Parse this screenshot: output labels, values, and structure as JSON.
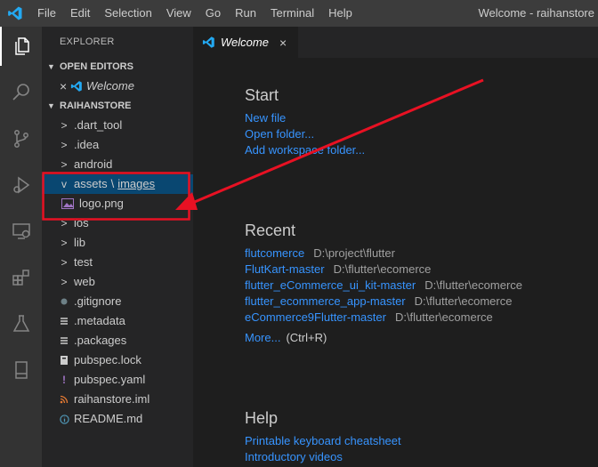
{
  "menu": [
    "File",
    "Edit",
    "Selection",
    "View",
    "Go",
    "Run",
    "Terminal",
    "Help"
  ],
  "window_title": "Welcome - raihanstore",
  "activity": [
    "explorer-icon",
    "search-icon",
    "source-control-icon",
    "run-debug-icon",
    "remote-explorer-icon",
    "extensions-icon",
    "testing-icon",
    "device-icon"
  ],
  "sidebar": {
    "title": "EXPLORER",
    "open_editors": {
      "label": "OPEN EDITORS",
      "items": [
        {
          "close": "×",
          "name": "Welcome"
        }
      ]
    },
    "project": {
      "label": "RAIHANSTORE",
      "items": [
        {
          "chevron": ">",
          "label": ".dart_tool"
        },
        {
          "chevron": ">",
          "label": ".idea"
        },
        {
          "chevron": ">",
          "label": "android"
        },
        {
          "chevron": "v",
          "label": "assets",
          "sep": "\\",
          "sub": "images"
        },
        {
          "label": "logo.png"
        },
        {
          "chevron": ">",
          "label": "ios"
        },
        {
          "chevron": ">",
          "label": "lib"
        },
        {
          "chevron": ">",
          "label": "test"
        },
        {
          "chevron": ">",
          "label": "web"
        },
        {
          "label": ".gitignore"
        },
        {
          "label": ".metadata"
        },
        {
          "label": ".packages"
        },
        {
          "label": "pubspec.lock"
        },
        {
          "label": "pubspec.yaml"
        },
        {
          "label": "raihanstore.iml"
        },
        {
          "label": "README.md"
        }
      ]
    }
  },
  "tab": {
    "label": "Welcome",
    "close": "×"
  },
  "welcome": {
    "start": {
      "heading": "Start",
      "links": [
        "New file",
        "Open folder...",
        "Add workspace folder..."
      ]
    },
    "recent": {
      "heading": "Recent",
      "items": [
        {
          "name": "flutcomerce",
          "path": "D:\\project\\flutter"
        },
        {
          "name": "FlutKart-master",
          "path": "D:\\flutter\\ecomerce"
        },
        {
          "name": "flutter_eCommerce_ui_kit-master",
          "path": "D:\\flutter\\ecomerce"
        },
        {
          "name": "flutter_ecommerce_app-master",
          "path": "D:\\flutter\\ecomerce"
        },
        {
          "name": "eCommerce9Flutter-master",
          "path": "D:\\flutter\\ecomerce"
        }
      ],
      "more": "More...",
      "shortcut": "(Ctrl+R)"
    },
    "help": {
      "heading": "Help",
      "links": [
        "Printable keyboard cheatsheet",
        "Introductory videos"
      ]
    }
  },
  "colors": {
    "accent": "#3794ff",
    "selection": "#094771",
    "annotation": "#e81123"
  }
}
